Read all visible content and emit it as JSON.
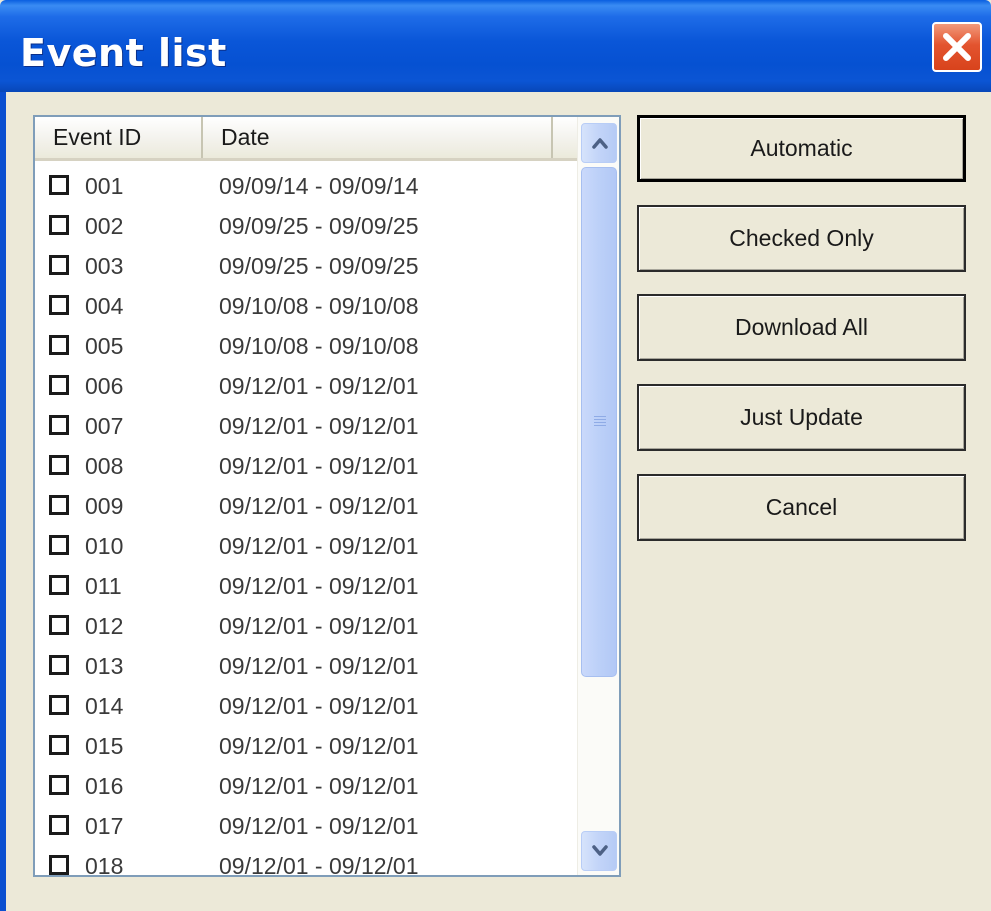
{
  "window": {
    "title": "Event list",
    "close_icon": "close-x-icon"
  },
  "list": {
    "columns": [
      "Event ID",
      "Date"
    ],
    "rows": [
      {
        "id": "001",
        "date": "09/09/14 - 09/09/14",
        "checked": false
      },
      {
        "id": "002",
        "date": "09/09/25 - 09/09/25",
        "checked": false
      },
      {
        "id": "003",
        "date": "09/09/25 - 09/09/25",
        "checked": false
      },
      {
        "id": "004",
        "date": "09/10/08 - 09/10/08",
        "checked": false
      },
      {
        "id": "005",
        "date": "09/10/08 - 09/10/08",
        "checked": false
      },
      {
        "id": "006",
        "date": "09/12/01 - 09/12/01",
        "checked": false
      },
      {
        "id": "007",
        "date": "09/12/01 - 09/12/01",
        "checked": false
      },
      {
        "id": "008",
        "date": "09/12/01 - 09/12/01",
        "checked": false
      },
      {
        "id": "009",
        "date": "09/12/01 - 09/12/01",
        "checked": false
      },
      {
        "id": "010",
        "date": "09/12/01 - 09/12/01",
        "checked": false
      },
      {
        "id": "011",
        "date": "09/12/01 - 09/12/01",
        "checked": false
      },
      {
        "id": "012",
        "date": "09/12/01 - 09/12/01",
        "checked": false
      },
      {
        "id": "013",
        "date": "09/12/01 - 09/12/01",
        "checked": false
      },
      {
        "id": "014",
        "date": "09/12/01 - 09/12/01",
        "checked": false
      },
      {
        "id": "015",
        "date": "09/12/01 - 09/12/01",
        "checked": false
      },
      {
        "id": "016",
        "date": "09/12/01 - 09/12/01",
        "checked": false
      },
      {
        "id": "017",
        "date": "09/12/01 - 09/12/01",
        "checked": false
      },
      {
        "id": "018",
        "date": "09/12/01 - 09/12/01",
        "checked": false
      }
    ]
  },
  "buttons": {
    "automatic": "Automatic",
    "checked_only": "Checked Only",
    "download_all": "Download All",
    "just_update": "Just Update",
    "cancel": "Cancel"
  },
  "colors": {
    "titlebar": "#0a56d8",
    "window_bg": "#ece9d8",
    "close_button": "#e3542f",
    "scrollbar": "#c2d4f8"
  }
}
